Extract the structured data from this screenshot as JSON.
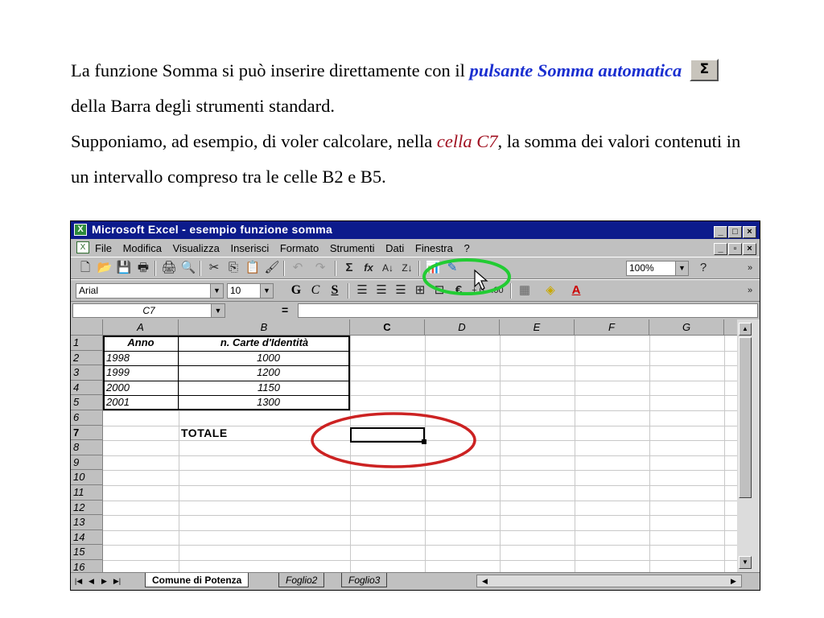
{
  "intro": {
    "part1": "La funzione Somma si può inserire direttamente con il ",
    "blue_emphasis": "pulsante Somma automatica",
    "sigma_symbol": "Σ",
    "part2": " della Barra degli strumenti standard.",
    "part3": "Supponiamo, ad esempio, di voler calcolare, nella ",
    "red_emphasis": "cella C7",
    "part4": ", la somma dei valori contenuti in un intervallo compreso tra le celle B2 e B5."
  },
  "excel": {
    "title": "Microsoft Excel - esempio funzione somma",
    "menu": [
      "File",
      "Modifica",
      "Visualizza",
      "Inserisci",
      "Formato",
      "Strumenti",
      "Dati",
      "Finestra",
      "?"
    ],
    "toolbar": {
      "zoom": "100%",
      "font": "Arial",
      "font_size": "10",
      "bold_label": "G",
      "italic_label": "C",
      "underline_label": "S",
      "autosum_symbol": "Σ",
      "function_symbol": "fx",
      "euro_symbol": "€"
    },
    "name_box": "C7",
    "formula_equals": "=",
    "columns": [
      "A",
      "B",
      "C",
      "D",
      "E",
      "F",
      "G"
    ],
    "rows": [
      "1",
      "2",
      "3",
      "4",
      "5",
      "6",
      "7",
      "8",
      "9",
      "10",
      "11",
      "12",
      "13",
      "14",
      "15",
      "16"
    ],
    "active_column": "C",
    "active_row": "7",
    "table": {
      "header_a": "Anno",
      "header_b": "n. Carte d'Identità",
      "years": [
        "1998",
        "1999",
        "2000",
        "2001"
      ],
      "counts": [
        "1000",
        "1200",
        "1150",
        "1300"
      ]
    },
    "total_label": "TOTALE",
    "sheets": [
      "Comune di Potenza",
      "Foglio2",
      "Foglio3"
    ],
    "active_sheet": "Comune di Potenza"
  },
  "colors": {
    "title_bar": "#0c1b8c",
    "highlight_green": "#22cc33",
    "highlight_red": "#cc2222",
    "blue_text": "#1a2fd0",
    "red_text": "#a01020"
  }
}
